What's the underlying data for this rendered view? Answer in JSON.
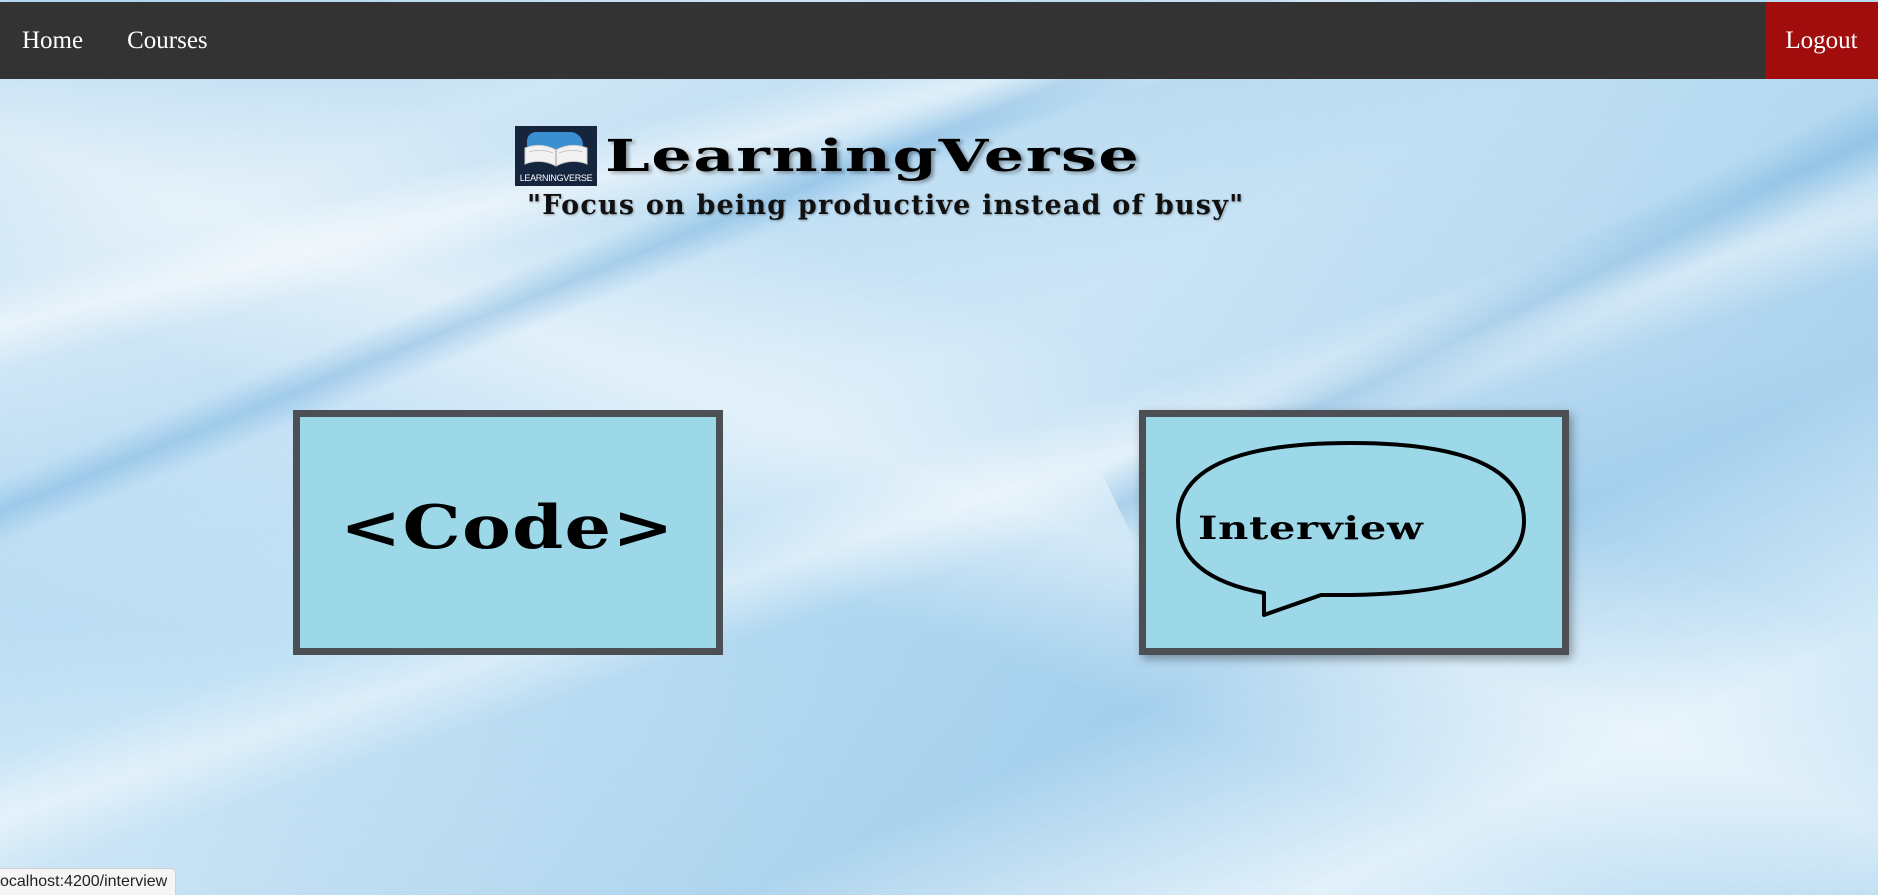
{
  "nav": {
    "home_label": "Home",
    "courses_label": "Courses",
    "logout_label": "Logout"
  },
  "brand": {
    "logo_text": "LEARNINGVERSE",
    "name": "LearningVerse",
    "tagline": "\"Focus on being productive instead of busy\""
  },
  "cards": {
    "code_label": "<Code>",
    "interview_label": "Interview"
  },
  "status": {
    "url": "ocalhost:4200/interview"
  },
  "colors": {
    "navbar": "#333333",
    "logout": "#a10d0d",
    "card_fill": "#9dd8e9",
    "card_border": "#4c5055"
  }
}
